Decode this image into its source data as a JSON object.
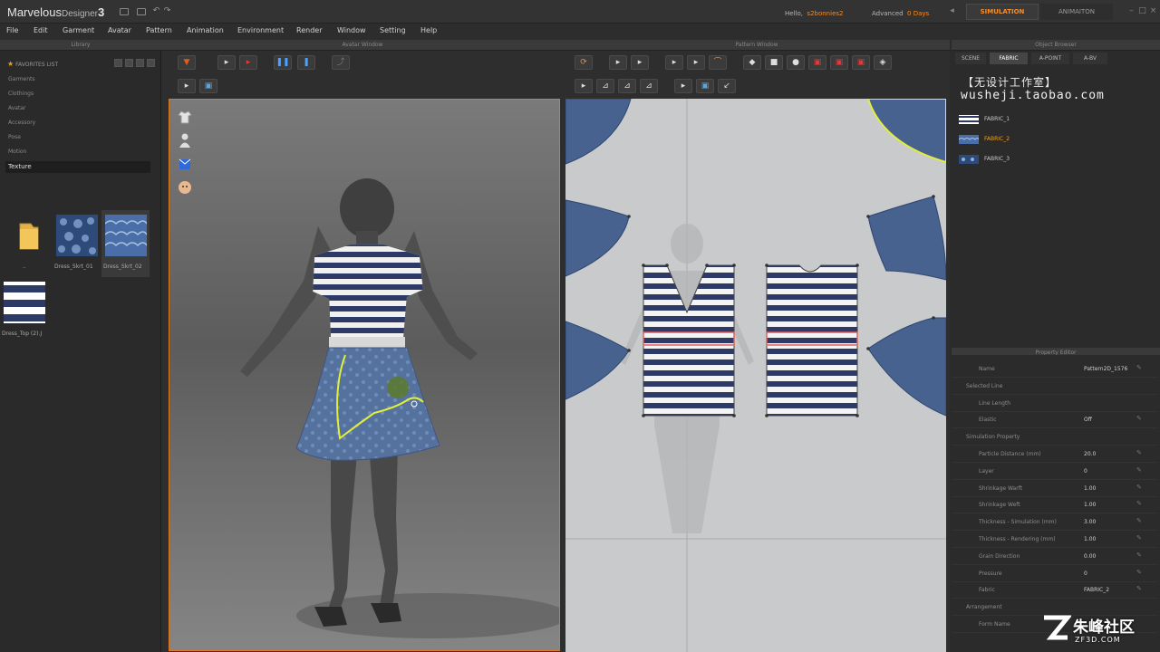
{
  "app": {
    "name": "Marvelous",
    "name_sub": "Designer",
    "version": "3"
  },
  "topbar": {
    "hello_label": "Hello,",
    "user": "s2bonnies2",
    "advanced_label": "Advanced",
    "days": "0 Days",
    "tabs": {
      "simulation": "SIMULATION",
      "animation": "ANIMAITON"
    }
  },
  "menu": [
    "File",
    "Edit",
    "Garment",
    "Avatar",
    "Pattern",
    "Animation",
    "Environment",
    "Render",
    "Window",
    "Setting",
    "Help"
  ],
  "panels": {
    "library": "Library",
    "avatar_window": "Avatar Window",
    "pattern_window": "Pattern Window",
    "object_browser": "Object Browser",
    "property_editor": "Property Editor"
  },
  "library": {
    "favorites": "FAVORITES LIST",
    "items": [
      "Garments",
      "Clothings",
      "Avatar",
      "Accessory",
      "Pose",
      "Motion"
    ],
    "selected": "Texture",
    "thumbs": [
      "..",
      "Dress_Skrt_01",
      "Dress_Skrt_02",
      "Dress_Top (2).J"
    ]
  },
  "object_browser": {
    "tabs": [
      "SCENE",
      "FABRIC",
      "A-POINT",
      "A-BV"
    ],
    "watermark_cn": "【无设计工作室】",
    "watermark_url": "wusheji.taobao.com",
    "fabrics": [
      "FABRIC_1",
      "FABRIC_2",
      "FABRIC_3"
    ]
  },
  "property_editor": {
    "rows": [
      {
        "key": "Name",
        "value": "Pattern2D_1576",
        "section": false
      },
      {
        "key": "Selected Line",
        "value": "",
        "section": true
      },
      {
        "key": "Line Length",
        "value": "",
        "section": false
      },
      {
        "key": "Elastic",
        "value": "Off",
        "section": false
      },
      {
        "key": "Simulation Property",
        "value": "",
        "section": true
      },
      {
        "key": "Particle Distance (mm)",
        "value": "20.0",
        "section": false
      },
      {
        "key": "Layer",
        "value": "0",
        "section": false
      },
      {
        "key": "Shrinkage Warft",
        "value": "1.00",
        "section": false
      },
      {
        "key": "Shrinkage Weft",
        "value": "1.00",
        "section": false
      },
      {
        "key": "Thickness - Simulation (mm)",
        "value": "3.00",
        "section": false
      },
      {
        "key": "Thickness - Rendering (mm)",
        "value": "1.00",
        "section": false
      },
      {
        "key": "Grain Direction",
        "value": "0.00",
        "section": false
      },
      {
        "key": "Pressure",
        "value": "0",
        "section": false
      },
      {
        "key": "Fabric",
        "value": "FABRIC_2",
        "section": false
      },
      {
        "key": "Arrangement",
        "value": "",
        "section": true
      },
      {
        "key": "Form Name",
        "value": "",
        "section": false
      }
    ]
  },
  "watermark": {
    "cn": "朱峰社区",
    "url": "ZF3D.COM"
  },
  "colors": {
    "accent": "#ff8a1e",
    "stripe_blue": "#2d3a66",
    "fabric_blue": "#47628f"
  }
}
